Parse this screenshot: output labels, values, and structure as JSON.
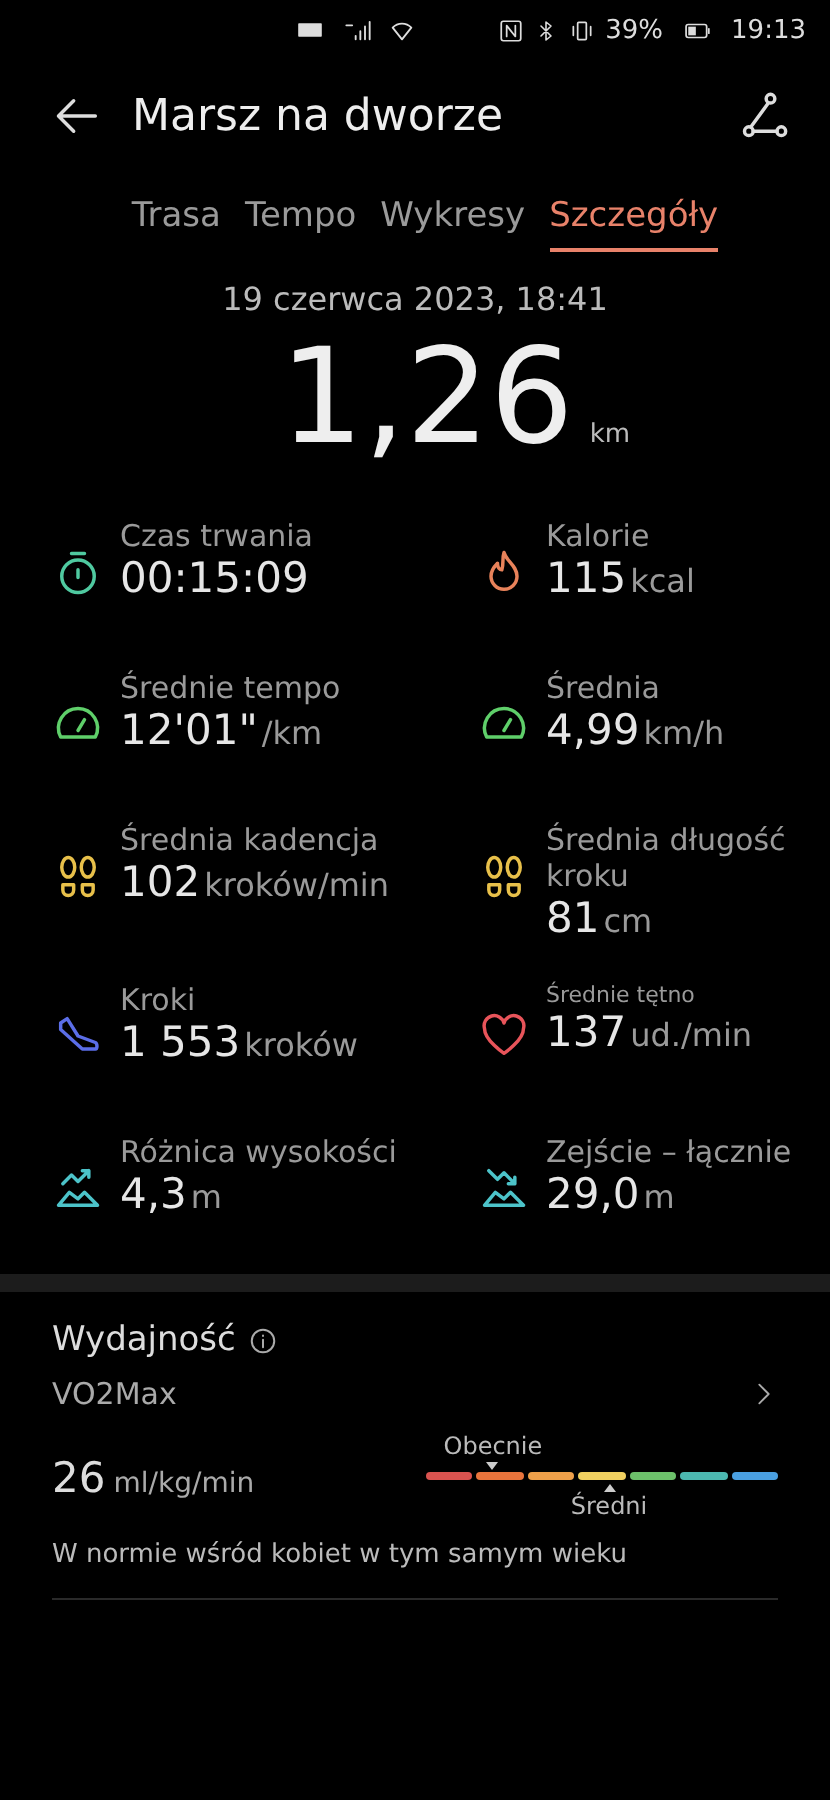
{
  "status_bar": {
    "battery": "39%",
    "time": "19:13"
  },
  "header": {
    "title": "Marsz na dworze"
  },
  "tabs": [
    {
      "label": "Trasa",
      "selected": false
    },
    {
      "label": "Tempo",
      "selected": false
    },
    {
      "label": "Wykresy",
      "selected": false
    },
    {
      "label": "Szczegóły",
      "selected": true
    }
  ],
  "date": "19 czerwca 2023, 18:41",
  "distance": {
    "value": "1,26",
    "unit": "km"
  },
  "metrics": [
    {
      "kind": "timer",
      "color": "#4fc9a0",
      "label": "Czas trwania",
      "value": "00:15:09"
    },
    {
      "kind": "flame",
      "color": "#e8825a",
      "label": "Kalorie",
      "value": "115",
      "unit": "kcal"
    },
    {
      "kind": "gauge",
      "color": "#5fcf6a",
      "label": "Średnie tempo",
      "value": "12'01\"",
      "unit": "/km"
    },
    {
      "kind": "gauge",
      "color": "#5fcf6a",
      "label": "Średnia",
      "value": "4,99",
      "unit": "km/h"
    },
    {
      "kind": "feet",
      "color": "#e8c04a",
      "label": "Średnia kadencja",
      "value": "102",
      "unit": "kroków/min"
    },
    {
      "kind": "feet",
      "color": "#e8c04a",
      "label": "Średnia długość kroku",
      "value": "81",
      "unit": "cm"
    },
    {
      "kind": "shoe",
      "color": "#5b6ee8",
      "label": "Kroki",
      "value": "1 553",
      "unit": "kroków"
    },
    {
      "kind": "heart",
      "color": "#e8545a",
      "label": "Średnie tętno",
      "value": "137",
      "unit": "ud./min"
    },
    {
      "kind": "climb",
      "color": "#4cc3c9",
      "label": "Różnica wysokości",
      "value": "4,3",
      "unit": "m"
    },
    {
      "kind": "descent",
      "color": "#4cc3c9",
      "label": "Zejście – łącznie",
      "value": "29,0",
      "unit": "m"
    }
  ],
  "performance": {
    "title": "Wydajność",
    "metric": "VO2Max",
    "value": "26",
    "unit": "ml/kg/min",
    "scale": [
      {
        "color": "#d9534f"
      },
      {
        "color": "#e8743c"
      },
      {
        "color": "#eea04a"
      },
      {
        "color": "#f0d060"
      },
      {
        "color": "#6cc06a"
      },
      {
        "color": "#4cb8b0"
      },
      {
        "color": "#4a9fe0"
      }
    ],
    "current": {
      "label": "Obecnie"
    },
    "average": {
      "label": "Średni"
    },
    "note": "W normie wśród kobiet w tym samym wieku"
  }
}
